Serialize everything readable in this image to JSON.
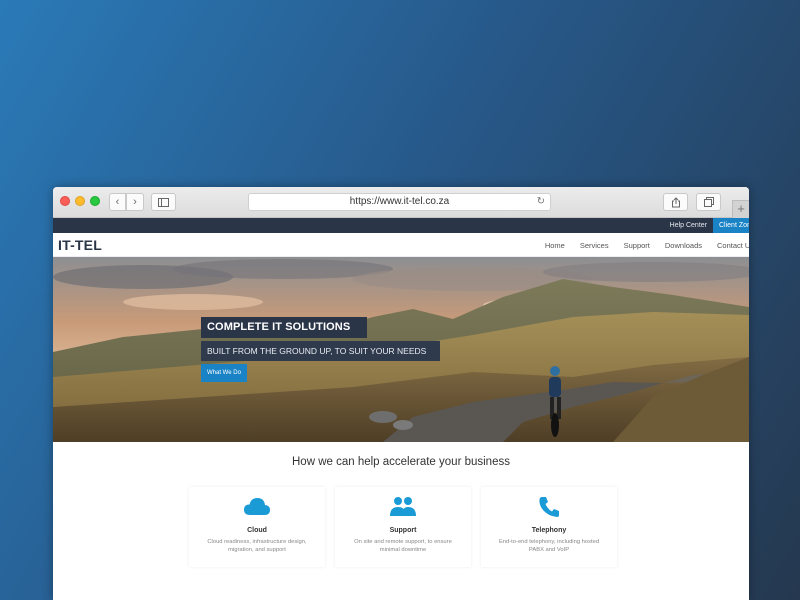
{
  "browser": {
    "url": "https://www.it-tel.co.za"
  },
  "site": {
    "topbar": {
      "help_center": "Help Center",
      "client_zone": "Client Zone"
    },
    "logo": "IT-TEL",
    "menu": [
      "Home",
      "Services",
      "Support",
      "Downloads",
      "Contact Us"
    ],
    "hero": {
      "title": "COMPLETE IT SOLUTIONS",
      "subtitle": "BUILT FROM THE GROUND UP, TO SUIT YOUR NEEDS",
      "button": "What We Do"
    },
    "section_heading": "How we can help accelerate your business",
    "cards": [
      {
        "icon": "cloud-icon",
        "title": "Cloud",
        "description": "Cloud readiness, infrastructure design, migration, and support"
      },
      {
        "icon": "users-icon",
        "title": "Support",
        "description": "On site and remote support, to ensure minimal downtime"
      },
      {
        "icon": "phone-icon",
        "title": "Telephony",
        "description": "End-to-end telephony, including hosted PABX and VoIP"
      }
    ],
    "colors": {
      "navy": "#2b3548",
      "accent_blue": "#1a83c6"
    }
  }
}
